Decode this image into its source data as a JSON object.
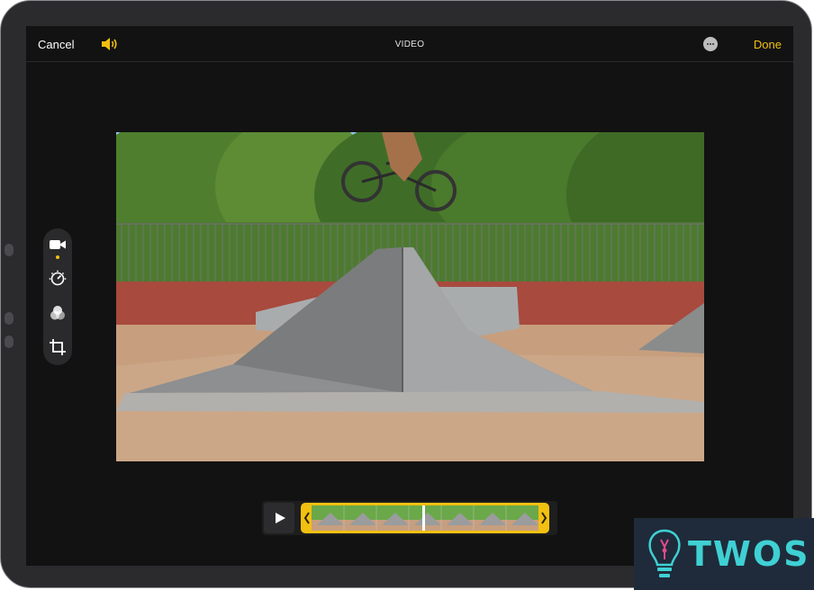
{
  "header": {
    "cancel_label": "Cancel",
    "title": "VIDEO",
    "done_label": "Done"
  },
  "icons": {
    "speaker": "speaker-wave-icon",
    "more": "ellipsis-icon",
    "video": "video-camera-icon",
    "adjust": "adjust-dial-icon",
    "filters": "filters-circles-icon",
    "crop": "crop-icon",
    "play": "play-icon"
  },
  "colors": {
    "accent": "#f2c010",
    "screen": "#121212",
    "logo_text": "#3fd0d4"
  },
  "tools": {
    "active": "video"
  },
  "trim": {
    "playhead_fraction": 0.49
  },
  "watermark": {
    "text": "TWOS"
  }
}
